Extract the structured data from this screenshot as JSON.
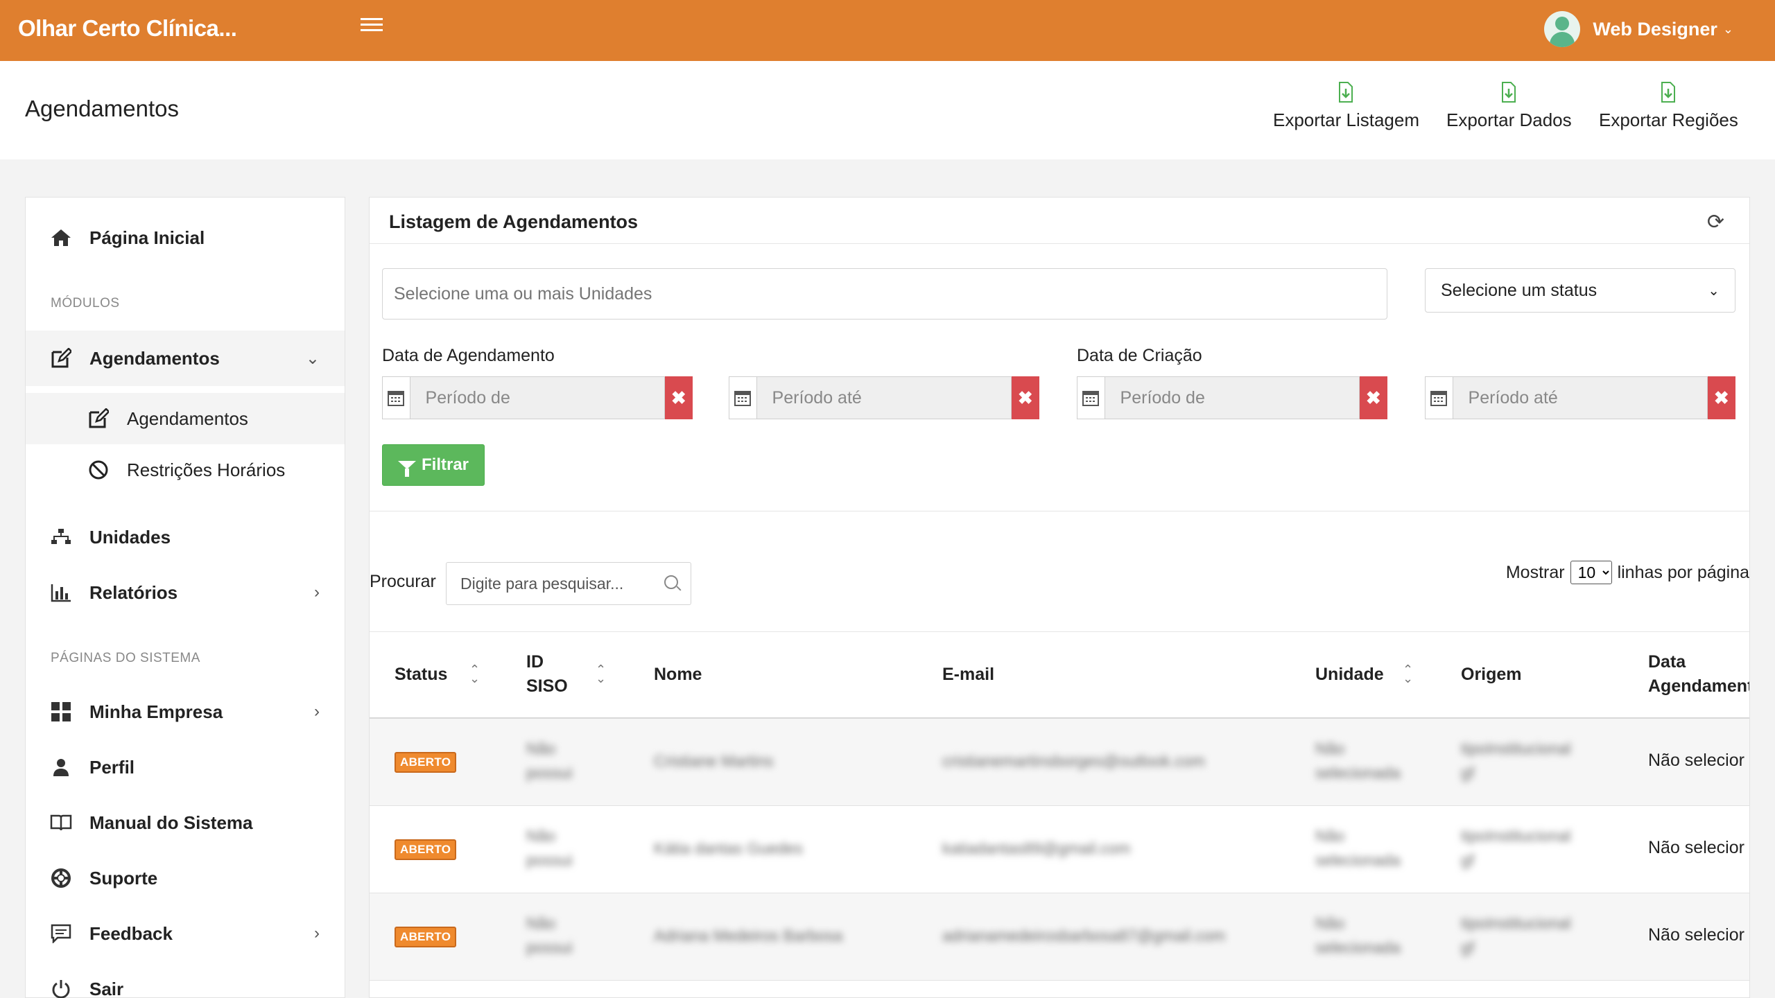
{
  "header": {
    "brand": "Olhar Certo Clínica...",
    "user_name": "Web Designer",
    "accent_color": "#df7f2f"
  },
  "page": {
    "title": "Agendamentos",
    "exports": [
      {
        "label": "Exportar Listagem",
        "icon": "file-download-icon"
      },
      {
        "label": "Exportar Dados",
        "icon": "file-download-icon"
      },
      {
        "label": "Exportar Regiões",
        "icon": "file-download-icon"
      }
    ]
  },
  "sidebar": {
    "home": "Página Inicial",
    "section_modules": "MÓDULOS",
    "agendamentos": "Agendamentos",
    "sub_agendamentos": "Agendamentos",
    "sub_restricoes": "Restrições Horários",
    "unidades": "Unidades",
    "relatorios": "Relatórios",
    "section_system": "PÁGINAS DO SISTEMA",
    "minha_empresa": "Minha Empresa",
    "perfil": "Perfil",
    "manual": "Manual do Sistema",
    "suporte": "Suporte",
    "feedback": "Feedback",
    "sair": "Sair"
  },
  "panel": {
    "title": "Listagem de Agendamentos",
    "units_placeholder": "Selecione uma ou mais Unidades",
    "status_placeholder": "Selecione um status",
    "date_scheduling_label": "Data de Agendamento",
    "date_creation_label": "Data de Criação",
    "period_from": "Período de",
    "period_to": "Período até",
    "filter_label": "Filtrar",
    "search_label": "Procurar",
    "search_placeholder": "Digite para pesquisar...",
    "show_label": "Mostrar",
    "rows_per_page": "10",
    "rows_suffix": "linhas por página"
  },
  "table": {
    "columns": {
      "status": "Status",
      "id_line1": "ID",
      "id_line2": "SISO",
      "nome": "Nome",
      "email": "E-mail",
      "unidade": "Unidade",
      "origem": "Origem",
      "data_line1": "Data",
      "data_line2": "Agendament"
    },
    "rows": [
      {
        "status": "ABERTO",
        "id_a": "Não",
        "id_b": "possui",
        "nome": "Cristiane Martins",
        "email": "cristianemartinsborges@outlook.com",
        "unidade_a": "Não",
        "unidade_b": "selecionada",
        "origem_a": "tipoInstitucional",
        "origem_b": "gf",
        "data": "Não selecior"
      },
      {
        "status": "ABERTO",
        "id_a": "Não",
        "id_b": "possui",
        "nome": "Kátia dantas Guedes",
        "email": "katiadantas89@gmail.com",
        "unidade_a": "Não",
        "unidade_b": "selecionada",
        "origem_a": "tipoInstitucional",
        "origem_b": "gf",
        "data": "Não selecior"
      },
      {
        "status": "ABERTO",
        "id_a": "Não",
        "id_b": "possui",
        "nome": "Adriana Medeiros Barbosa",
        "email": "adrianamedeirosbarbosa87@gmail.com",
        "unidade_a": "Não",
        "unidade_b": "selecionada",
        "origem_a": "tipoInstitucional",
        "origem_b": "gf",
        "data": "Não selecior"
      }
    ]
  }
}
